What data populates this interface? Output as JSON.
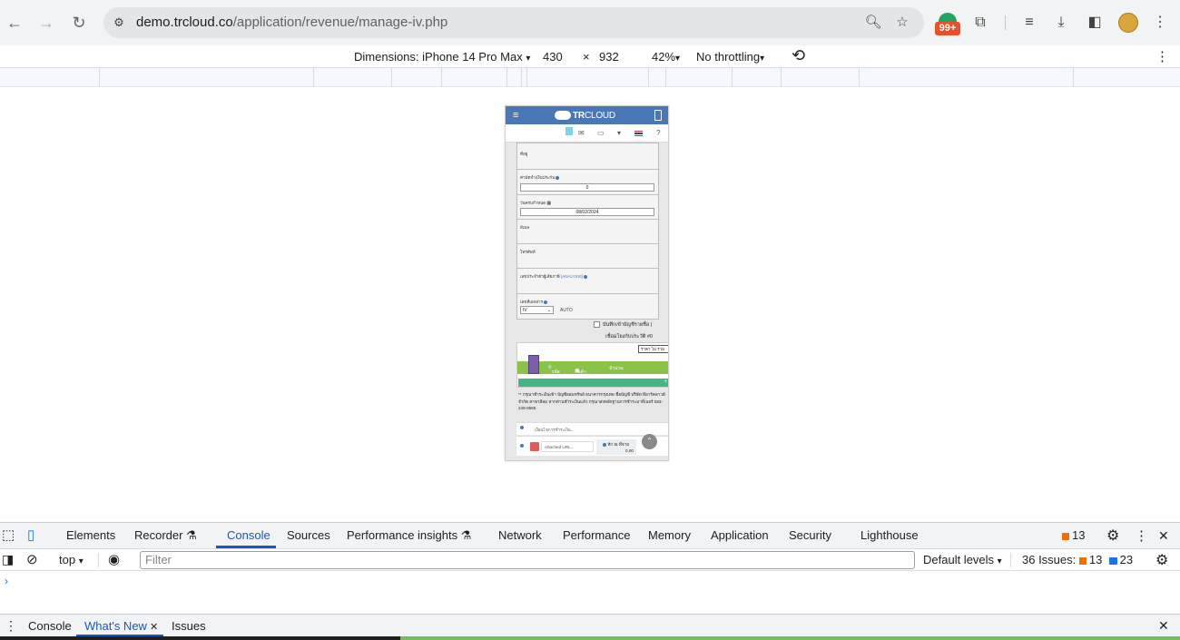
{
  "browser": {
    "url_domain": "demo.trcloud.co",
    "url_path": "/application/revenue/manage-iv.php",
    "extension_badge": "99+",
    "icons": {
      "back": "←",
      "forward": "→",
      "reload": "↻",
      "site": "⚙",
      "zoom": "🔍︎",
      "star": "☆",
      "extensions": "⧉",
      "media": "≡",
      "download": "⤓",
      "side_panel": "◧",
      "menu": "⋮"
    }
  },
  "device_toolbar": {
    "dimensions_label": "Dimensions: iPhone 14 Pro Max",
    "width": "430",
    "times": "×",
    "height": "932",
    "zoom": "42%",
    "throttling": "No throttling",
    "rotate_icon": "⟲",
    "more_icon": "⋮",
    "caret": "▾"
  },
  "app": {
    "logo_bold": "TR",
    "logo_rest": "CLOUD",
    "burger": "≡",
    "subtoolbar_icons": [
      "✉",
      "▭",
      "▾",
      "?"
    ],
    "form": {
      "address_label": "ที่อยู่",
      "deposit_label": "ค่ามัดจำ/เงินประกัน",
      "deposit_value": "0",
      "due_date_label": "วันครบกำหนด",
      "due_date_value": "08/02/2024",
      "email_label": "อีเมล",
      "phone_label": "โทรศัพท์",
      "tax_id_label": "เลขประจำตัวผู้เสียภาษี",
      "analysis_link": "[ANALYSIS]",
      "doc_no_label": "เลขที่เอกสาร",
      "doc_prefix": "IV",
      "doc_auto": "AUTO"
    },
    "save_checkbox_label": "บันทึกเข้าบัญชีรายชื่อ |",
    "link_history": "เชื่อมโยงกับประวัติ #0",
    "items_table": {
      "columns": [
        "#",
        "รหัส",
        "สินค้า",
        "จำนวน"
      ],
      "discount_select": "ราคา ไม่ รวม"
    },
    "add_row_icon": "+",
    "note": "** กรุณาชำระเงินเข้า บัญชีออมทรัพย์ ธนาคารกรุงเทพ ชื่อบัญชี บริษัท ทีอาร์คลาวด์ จำกัด สาขาสีลม หากท่านชำระเงินแล้ว กรุณาส่งหลักฐานการชำระมาที่เบอร์ 083-248-6555",
    "payment_placeholder": "เงื่อนไขการชำระเงิน...",
    "attach_placeholder": "Attached URL...",
    "total_label": "หัก ณ ที่จ่าย",
    "total_value": "0.00",
    "scroll_top_icon": "⌃"
  },
  "devtools": {
    "tabs": [
      "Elements",
      "Recorder ⚗",
      "Console",
      "Sources",
      "Performance insights ⚗",
      "Network",
      "Performance",
      "Memory",
      "Application",
      "Security",
      "Lighthouse"
    ],
    "active_tab": "Console",
    "issue_count": "13",
    "context": "top",
    "filter_placeholder": "Filter",
    "levels": "Default levels",
    "issues_label": "36 Issues:",
    "issues_warn": "13",
    "issues_info": "23",
    "drawer_tabs": [
      "Console",
      "What's New",
      "Issues"
    ],
    "drawer_active": "What's New",
    "close_icon": "✕",
    "gear_icon": "⚙",
    "menu_icon": "⋮",
    "prompt": "›"
  }
}
